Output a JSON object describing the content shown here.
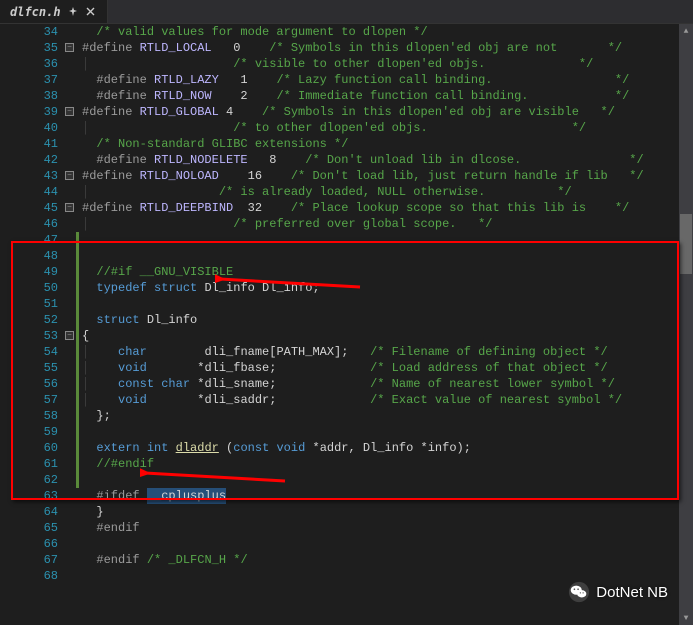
{
  "tab": {
    "filename": "dlfcn.h",
    "pinned": true
  },
  "watermark": "DotNet NB",
  "lines": [
    {
      "num": 34,
      "fold": "",
      "mod": "",
      "segs": [
        {
          "t": "  ",
          "c": ""
        },
        {
          "t": "/* valid values for mode argument to dlopen */",
          "c": "c-comment"
        }
      ]
    },
    {
      "num": 35,
      "fold": "⊟",
      "mod": "",
      "segs": [
        {
          "t": "#define ",
          "c": "c-kw2"
        },
        {
          "t": "RTLD_LOCAL",
          "c": "c-macroname"
        },
        {
          "t": "   0    ",
          "c": ""
        },
        {
          "t": "/* Symbols in this dlopen'ed obj are not       */",
          "c": "c-comment"
        }
      ]
    },
    {
      "num": 36,
      "fold": "|",
      "mod": "",
      "segs": [
        {
          "t": "                    ",
          "c": ""
        },
        {
          "t": "/* visible to other dlopen'ed objs.             */",
          "c": "c-comment"
        }
      ]
    },
    {
      "num": 37,
      "fold": "",
      "mod": "",
      "segs": [
        {
          "t": "  ",
          "c": ""
        },
        {
          "t": "#define ",
          "c": "c-kw2"
        },
        {
          "t": "RTLD_LAZY",
          "c": "c-macroname"
        },
        {
          "t": "   1    ",
          "c": ""
        },
        {
          "t": "/* Lazy function call binding.                 */",
          "c": "c-comment"
        }
      ]
    },
    {
      "num": 38,
      "fold": "",
      "mod": "",
      "segs": [
        {
          "t": "  ",
          "c": ""
        },
        {
          "t": "#define ",
          "c": "c-kw2"
        },
        {
          "t": "RTLD_NOW",
          "c": "c-macroname"
        },
        {
          "t": "    2    ",
          "c": ""
        },
        {
          "t": "/* Immediate function call binding.            */",
          "c": "c-comment"
        }
      ]
    },
    {
      "num": 39,
      "fold": "⊟",
      "mod": "",
      "segs": [
        {
          "t": "#define ",
          "c": "c-kw2"
        },
        {
          "t": "RTLD_GLOBAL",
          "c": "c-macroname"
        },
        {
          "t": " 4    ",
          "c": ""
        },
        {
          "t": "/* Symbols in this dlopen'ed obj are visible   */",
          "c": "c-comment"
        }
      ]
    },
    {
      "num": 40,
      "fold": "|",
      "mod": "",
      "segs": [
        {
          "t": "                    ",
          "c": ""
        },
        {
          "t": "/* to other dlopen'ed objs.                    */",
          "c": "c-comment"
        }
      ]
    },
    {
      "num": 41,
      "fold": "",
      "mod": "",
      "segs": [
        {
          "t": "  ",
          "c": ""
        },
        {
          "t": "/* Non-standard GLIBC extensions */",
          "c": "c-comment"
        }
      ]
    },
    {
      "num": 42,
      "fold": "",
      "mod": "",
      "segs": [
        {
          "t": "  ",
          "c": ""
        },
        {
          "t": "#define ",
          "c": "c-kw2"
        },
        {
          "t": "RTLD_NODELETE",
          "c": "c-macroname"
        },
        {
          "t": "   8    ",
          "c": ""
        },
        {
          "t": "/* Don't unload lib in dlcose.               */",
          "c": "c-comment"
        }
      ]
    },
    {
      "num": 43,
      "fold": "⊟",
      "mod": "",
      "segs": [
        {
          "t": "#define ",
          "c": "c-kw2"
        },
        {
          "t": "RTLD_NOLOAD",
          "c": "c-macroname"
        },
        {
          "t": "    16    ",
          "c": ""
        },
        {
          "t": "/* Don't load lib, just return handle if lib   */",
          "c": "c-comment"
        }
      ]
    },
    {
      "num": 44,
      "fold": "|",
      "mod": "",
      "segs": [
        {
          "t": "                  ",
          "c": ""
        },
        {
          "t": "/* is already loaded, NULL otherwise.          */",
          "c": "c-comment"
        }
      ]
    },
    {
      "num": 45,
      "fold": "⊟",
      "mod": "",
      "segs": [
        {
          "t": "#define ",
          "c": "c-kw2"
        },
        {
          "t": "RTLD_DEEPBIND",
          "c": "c-macroname"
        },
        {
          "t": "  32    ",
          "c": ""
        },
        {
          "t": "/* Place lookup scope so that this lib is    */",
          "c": "c-comment"
        }
      ]
    },
    {
      "num": 46,
      "fold": "|",
      "mod": "",
      "segs": [
        {
          "t": "                    ",
          "c": ""
        },
        {
          "t": "/* preferred over global scope.   */",
          "c": "c-comment"
        }
      ]
    },
    {
      "num": 47,
      "fold": "",
      "mod": "g",
      "segs": []
    },
    {
      "num": 48,
      "fold": "",
      "mod": "g",
      "segs": []
    },
    {
      "num": 49,
      "fold": "",
      "mod": "g",
      "segs": [
        {
          "t": "  ",
          "c": ""
        },
        {
          "t": "//#if __GNU_VISIBLE",
          "c": "c-comment"
        }
      ]
    },
    {
      "num": 50,
      "fold": "",
      "mod": "g",
      "segs": [
        {
          "t": "  ",
          "c": ""
        },
        {
          "t": "typedef",
          "c": "c-keyword"
        },
        {
          "t": " ",
          "c": ""
        },
        {
          "t": "struct",
          "c": "c-keyword"
        },
        {
          "t": " Dl_info Dl_info;",
          "c": ""
        }
      ]
    },
    {
      "num": 51,
      "fold": "",
      "mod": "g",
      "segs": []
    },
    {
      "num": 52,
      "fold": "",
      "mod": "g",
      "segs": [
        {
          "t": "  ",
          "c": ""
        },
        {
          "t": "struct",
          "c": "c-keyword"
        },
        {
          "t": " Dl_info",
          "c": ""
        }
      ]
    },
    {
      "num": 53,
      "fold": "⊟",
      "mod": "g",
      "segs": [
        {
          "t": "{",
          "c": ""
        }
      ]
    },
    {
      "num": 54,
      "fold": "|",
      "mod": "g",
      "segs": [
        {
          "t": "    ",
          "c": ""
        },
        {
          "t": "char",
          "c": "c-keyword"
        },
        {
          "t": "        dli_fname[PATH_MAX];   ",
          "c": ""
        },
        {
          "t": "/* Filename of defining object */",
          "c": "c-comment"
        }
      ]
    },
    {
      "num": 55,
      "fold": "|",
      "mod": "g",
      "segs": [
        {
          "t": "    ",
          "c": ""
        },
        {
          "t": "void",
          "c": "c-keyword"
        },
        {
          "t": "       *dli_fbase;             ",
          "c": ""
        },
        {
          "t": "/* Load address of that object */",
          "c": "c-comment"
        }
      ]
    },
    {
      "num": 56,
      "fold": "|",
      "mod": "g",
      "segs": [
        {
          "t": "    ",
          "c": ""
        },
        {
          "t": "const",
          "c": "c-keyword"
        },
        {
          "t": " ",
          "c": ""
        },
        {
          "t": "char",
          "c": "c-keyword"
        },
        {
          "t": " *dli_sname;             ",
          "c": ""
        },
        {
          "t": "/* Name of nearest lower symbol */",
          "c": "c-comment"
        }
      ]
    },
    {
      "num": 57,
      "fold": "|",
      "mod": "g",
      "segs": [
        {
          "t": "    ",
          "c": ""
        },
        {
          "t": "void",
          "c": "c-keyword"
        },
        {
          "t": "       *dli_saddr;             ",
          "c": ""
        },
        {
          "t": "/* Exact value of nearest symbol */",
          "c": "c-comment"
        }
      ]
    },
    {
      "num": 58,
      "fold": "",
      "mod": "g",
      "segs": [
        {
          "t": "  };",
          "c": ""
        }
      ]
    },
    {
      "num": 59,
      "fold": "",
      "mod": "g",
      "segs": []
    },
    {
      "num": 60,
      "fold": "",
      "mod": "g",
      "segs": [
        {
          "t": "  ",
          "c": ""
        },
        {
          "t": "extern",
          "c": "c-keyword"
        },
        {
          "t": " ",
          "c": ""
        },
        {
          "t": "int",
          "c": "c-keyword"
        },
        {
          "t": " ",
          "c": ""
        },
        {
          "t": "dladdr",
          "c": "c-func"
        },
        {
          "t": " (",
          "c": ""
        },
        {
          "t": "const",
          "c": "c-keyword"
        },
        {
          "t": " ",
          "c": ""
        },
        {
          "t": "void",
          "c": "c-keyword"
        },
        {
          "t": " *addr, Dl_info *info);",
          "c": ""
        }
      ]
    },
    {
      "num": 61,
      "fold": "",
      "mod": "g",
      "segs": [
        {
          "t": "  ",
          "c": ""
        },
        {
          "t": "//#endif",
          "c": "c-comment"
        }
      ]
    },
    {
      "num": 62,
      "fold": "",
      "mod": "g",
      "segs": []
    },
    {
      "num": 63,
      "fold": "",
      "mod": "",
      "segs": [
        {
          "t": "  ",
          "c": ""
        },
        {
          "t": "#ifdef ",
          "c": "c-kw2"
        },
        {
          "t": "__cplusplus",
          "c": "hl-sel"
        }
      ]
    },
    {
      "num": 64,
      "fold": "",
      "mod": "",
      "segs": [
        {
          "t": "  }",
          "c": ""
        }
      ]
    },
    {
      "num": 65,
      "fold": "",
      "mod": "",
      "segs": [
        {
          "t": "  ",
          "c": ""
        },
        {
          "t": "#endif",
          "c": "c-kw2"
        }
      ]
    },
    {
      "num": 66,
      "fold": "",
      "mod": "",
      "segs": []
    },
    {
      "num": 67,
      "fold": "",
      "mod": "",
      "segs": [
        {
          "t": "  ",
          "c": ""
        },
        {
          "t": "#endif",
          "c": "c-kw2"
        },
        {
          "t": " ",
          "c": ""
        },
        {
          "t": "/* _DLFCN_H */",
          "c": "c-comment"
        }
      ]
    },
    {
      "num": 68,
      "fold": "",
      "mod": "",
      "segs": []
    }
  ]
}
